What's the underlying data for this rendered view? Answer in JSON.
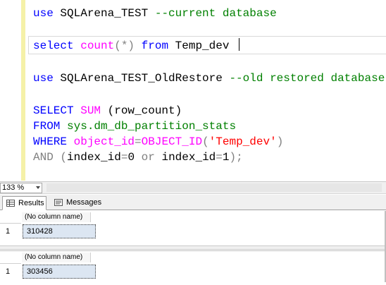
{
  "editor": {
    "line1": {
      "kw": "use",
      "db": " SQLArena_TEST ",
      "comment": "--current database"
    },
    "line2": {
      "kw1": "select",
      "fn": " count",
      "paren": "(*)",
      "kw2": " from",
      "table": " Temp_dev "
    },
    "line3": {
      "kw": "use",
      "db": " SQLArena_TEST_OldRestore ",
      "comment": "--old restored database"
    },
    "line4": {
      "kw": "SELECT",
      "fn": " SUM",
      "rest": " (row_count)"
    },
    "line5": {
      "kw": "FROM",
      "sys": " sys.dm_db_partition_stats"
    },
    "line6": {
      "kw": "WHERE",
      "fn": " object_id",
      "eq": "=",
      "fn2": "OBJECT_ID",
      "open": "(",
      "str": "'Temp_dev'",
      "close": ")"
    },
    "line7": {
      "kw": "AND",
      "open": " (",
      "col1": "index_id",
      "eq1": "=",
      "v1": "0",
      "or": " or",
      "col2": " index_id",
      "eq2": "=",
      "v2": "1",
      "close": ");"
    }
  },
  "zoom": {
    "value": "133 %"
  },
  "tabs": {
    "results": "Results",
    "messages": "Messages"
  },
  "results": [
    {
      "header": "(No column name)",
      "row_number": "1",
      "value": "310428"
    },
    {
      "header": "(No column name)",
      "row_number": "1",
      "value": "303456"
    }
  ],
  "colors": {
    "keyword": "#0000ff",
    "comment": "#008000",
    "function": "#ff00ff",
    "string": "#ff0000",
    "operator": "#808080",
    "selection": "#dce6f2"
  }
}
